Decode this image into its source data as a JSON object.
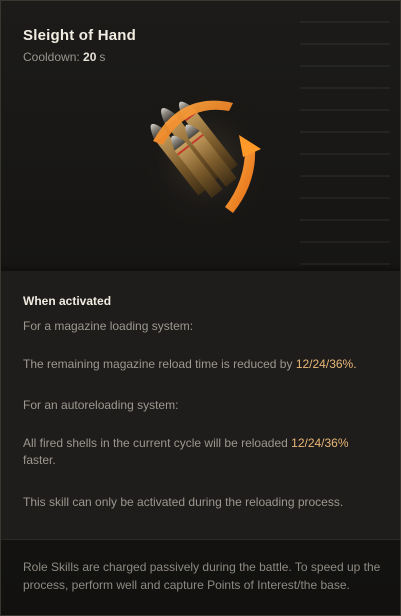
{
  "skill": {
    "title": "Sleight of Hand",
    "cooldown_label": "Cooldown:",
    "cooldown_value": "20",
    "cooldown_unit": "s",
    "icon": "ammo-shells-reload-icon"
  },
  "activation": {
    "heading": "When activated",
    "magazine_intro": "For a magazine loading system:",
    "magazine_text_prefix": "The remaining magazine reload time is reduced by",
    "magazine_values": "12/24/36%.",
    "autoloader_intro": "For an autoreloading system:",
    "autoloader_text_prefix": "All fired shells in the current cycle will be reloaded",
    "autoloader_values": "12/24/36%",
    "autoloader_text_suffix": "faster.",
    "restriction": "This skill can only be activated during the reloading process."
  },
  "footer": {
    "text": "Role Skills are charged passively during the battle. To speed up the process, perform well and capture Points of Interest/the base."
  },
  "colors": {
    "highlight": "#e8b777",
    "arrow_orange": "#ff8a1c"
  }
}
